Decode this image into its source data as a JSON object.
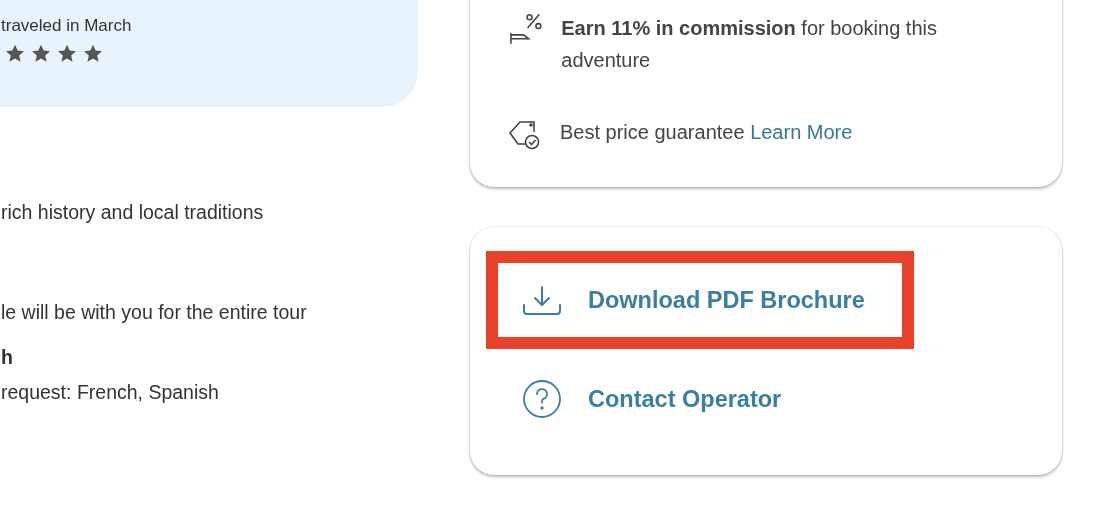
{
  "review": {
    "text": "traveled in March",
    "stars": 4
  },
  "highlights": [
    {
      "kind": "text",
      "text": "rich history and local traditions"
    },
    {
      "kind": "text",
      "text": "le will be with you for the entire tour"
    },
    {
      "kind": "heading",
      "text": "h"
    },
    {
      "kind": "text",
      "text": "request: French, Spanish"
    }
  ],
  "perks": [
    {
      "kind": "commission",
      "text": "**Earn 11% in commission** for booking this adventure"
    },
    {
      "kind": "price",
      "text": "Best price guarantee",
      "link": "Learn More"
    }
  ],
  "actions": [
    {
      "kind": "download",
      "label": "Download PDF Brochure",
      "highlighted": true
    },
    {
      "kind": "contact",
      "label": "Contact Operator",
      "highlighted": false
    }
  ]
}
